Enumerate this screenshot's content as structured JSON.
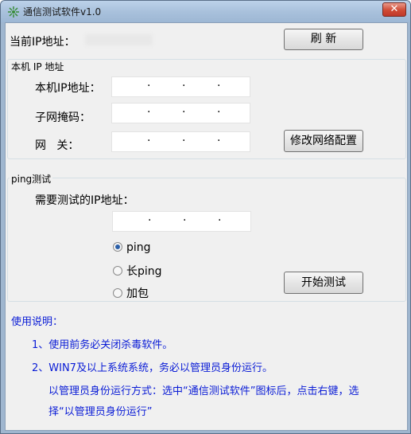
{
  "window": {
    "title": "通信测试软件v1.0",
    "close_glyph": "✕"
  },
  "current_ip": {
    "label": "当前IP地址：",
    "value": ""
  },
  "refresh_button": "刷  新",
  "local_ip_group": {
    "title": "本机 IP 地址",
    "ip_label": "本机IP地址：",
    "mask_label": "子网掩码：",
    "gateway_label": "网   关：",
    "modify_button": "修改网络配置"
  },
  "ping_group": {
    "title": "ping测试",
    "target_label": "需要测试的IP地址：",
    "options": [
      "ping",
      "长ping",
      "加包"
    ],
    "selected": "ping",
    "start_button": "开始测试"
  },
  "instructions": {
    "heading": "使用说明：",
    "line1": "1、使用前务必关闭杀毒软件。",
    "line2": "2、WIN7及以上系统系统，务必以管理员身份运行。",
    "line3": "以管理员身份运行方式：选中“通信测试软件”图标后，点击右键，选",
    "line4": "择“以管理员身份运行”"
  },
  "ip_dot": "·"
}
